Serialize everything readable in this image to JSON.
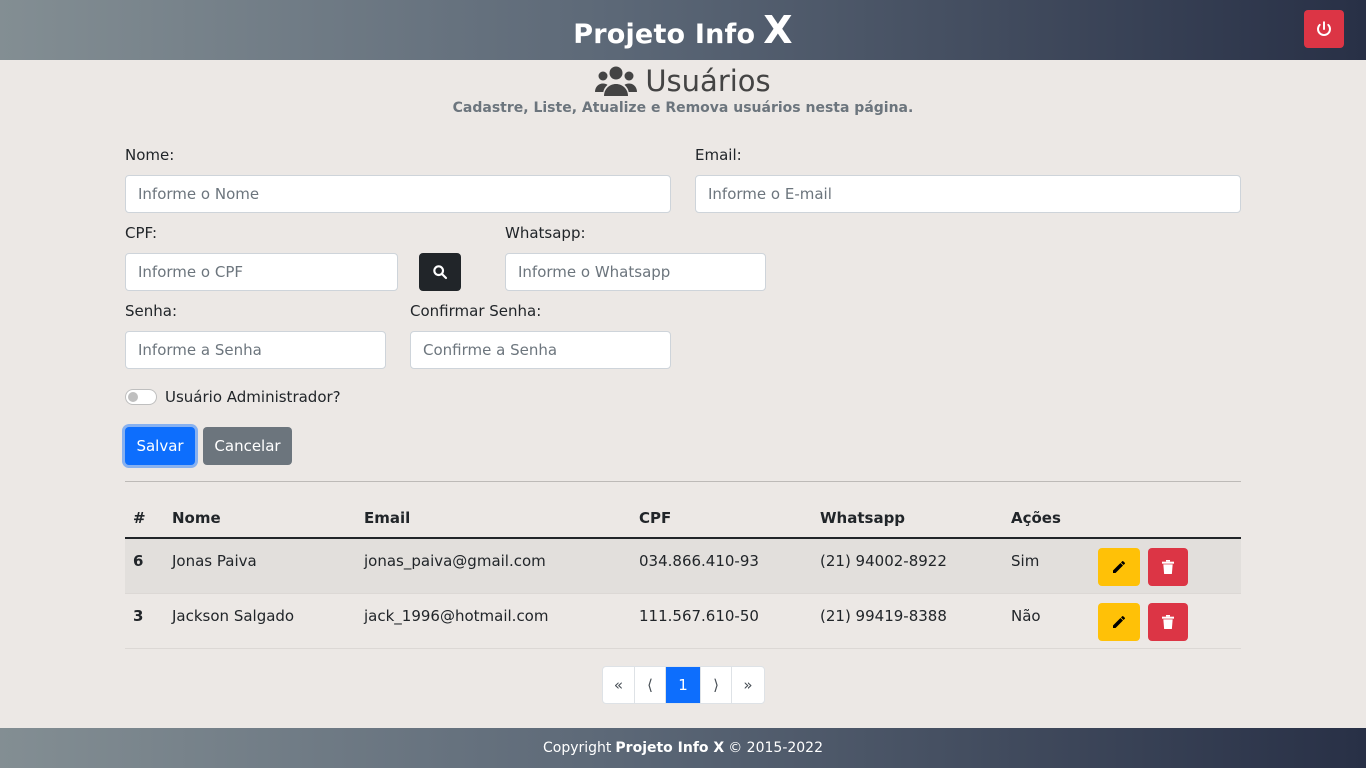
{
  "colors": {
    "primary": "#0d6efd",
    "danger": "#dc3545",
    "warning": "#ffc107",
    "secondary": "#6c757d",
    "dark": "#212529"
  },
  "header": {
    "brand_text": "Projeto Info",
    "brand_x": "X",
    "power_icon": "power-icon"
  },
  "page": {
    "icon": "users-icon",
    "title": "Usuários",
    "subtitle": "Cadastre, Liste, Atualize e Remova usuários nesta página."
  },
  "form": {
    "nome": {
      "label": "Nome:",
      "placeholder": "Informe o Nome",
      "value": ""
    },
    "email": {
      "label": "Email:",
      "placeholder": "Informe o E-mail",
      "value": ""
    },
    "cpf": {
      "label": "CPF:",
      "placeholder": "Informe o CPF",
      "value": ""
    },
    "cpf_search_icon": "search-icon",
    "whatsapp": {
      "label": "Whatsapp:",
      "placeholder": "Informe o Whatsapp",
      "value": ""
    },
    "senha": {
      "label": "Senha:",
      "placeholder": "Informe a Senha",
      "value": ""
    },
    "confirmar": {
      "label": "Confirmar Senha:",
      "placeholder": "Confirme a Senha",
      "value": ""
    },
    "admin": {
      "label": "Usuário Administrador?",
      "checked": false
    },
    "save_label": "Salvar",
    "cancel_label": "Cancelar"
  },
  "table": {
    "headers": {
      "id": "#",
      "nome": "Nome",
      "email": "Email",
      "cpf": "CPF",
      "whatsapp": "Whatsapp",
      "acoes": "Ações"
    },
    "rows": [
      {
        "id": "6",
        "nome": "Jonas Paiva",
        "email": "jonas_paiva@gmail.com",
        "cpf": "034.866.410-93",
        "whatsapp": "(21) 94002-8922",
        "admin": "Sim"
      },
      {
        "id": "3",
        "nome": "Jackson Salgado",
        "email": "jack_1996@hotmail.com",
        "cpf": "111.567.610-50",
        "whatsapp": "(21) 99419-8388",
        "admin": "Não"
      }
    ],
    "edit_icon": "pencil-icon",
    "delete_icon": "trash-icon"
  },
  "pagination": {
    "first": "«",
    "prev": "⟨",
    "current": "1",
    "next": "⟩",
    "last": "»"
  },
  "footer": {
    "prefix": "Copyright",
    "brand": "Projeto Info X",
    "suffix": "© 2015-2022"
  }
}
